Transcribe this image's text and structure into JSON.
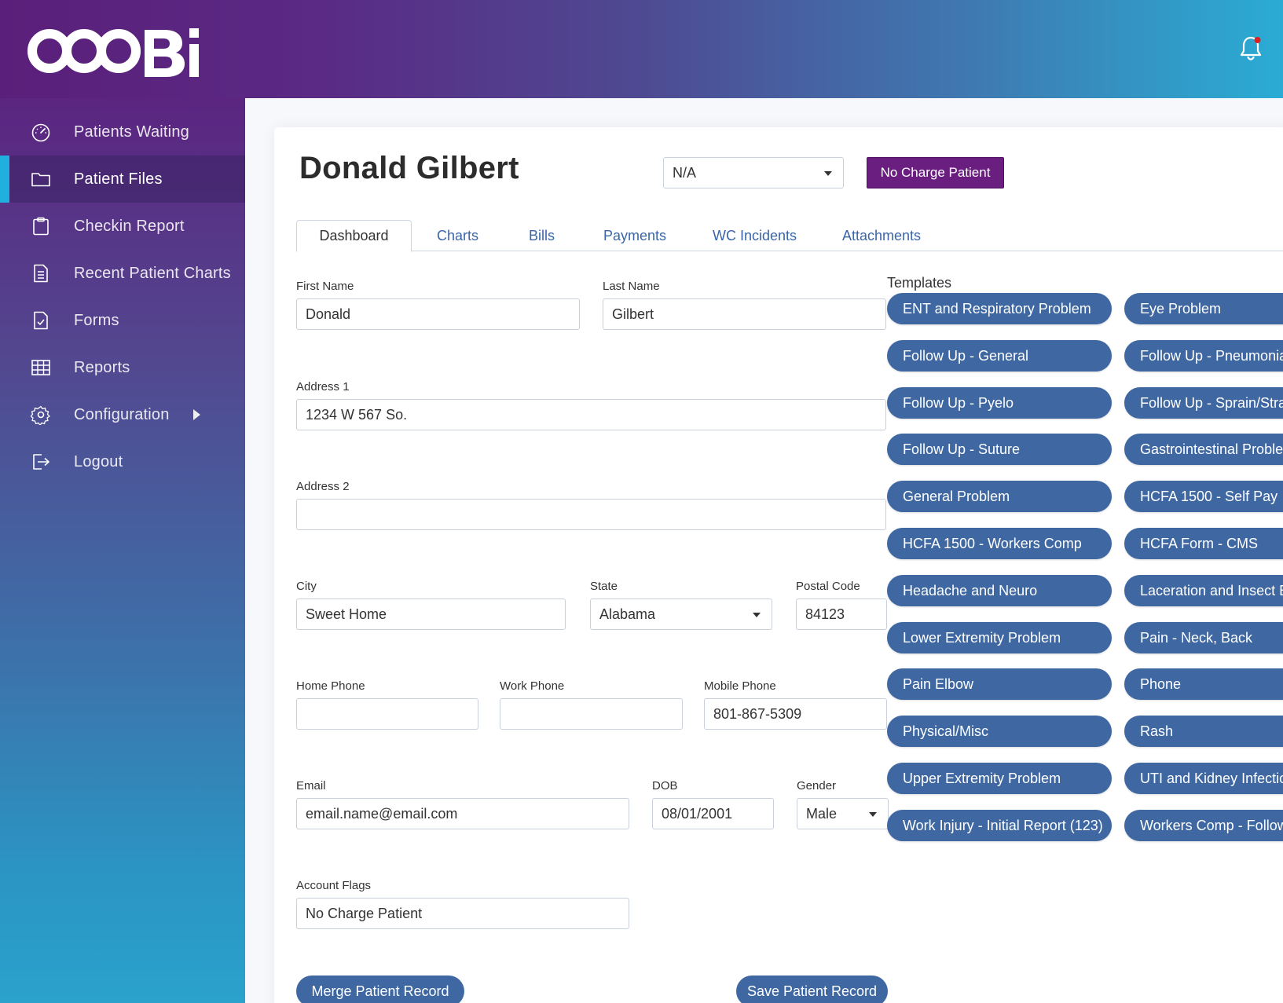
{
  "brand": {
    "logo_text": "OOOBi"
  },
  "sidebar": {
    "items": [
      {
        "label": "Patients Waiting",
        "icon": "dashboard-gauge-icon"
      },
      {
        "label": "Patient Files",
        "icon": "folder-icon",
        "active": true
      },
      {
        "label": "Checkin Report",
        "icon": "clipboard-icon"
      },
      {
        "label": "Recent Patient Charts",
        "icon": "document-icon"
      },
      {
        "label": "Forms",
        "icon": "form-check-icon"
      },
      {
        "label": "Reports",
        "icon": "table-grid-icon"
      },
      {
        "label": "Configuration",
        "icon": "gear-icon",
        "has_submenu": true
      },
      {
        "label": "Logout",
        "icon": "logout-icon"
      }
    ]
  },
  "header": {
    "notification_icon": "bell-icon",
    "has_unread": true
  },
  "patient": {
    "name": "Donald Gilbert",
    "status_select": "N/A",
    "no_charge_button": "No Charge Patient"
  },
  "tabs": [
    {
      "label": "Dashboard",
      "active": true
    },
    {
      "label": "Charts"
    },
    {
      "label": "Bills"
    },
    {
      "label": "Payments"
    },
    {
      "label": "WC Incidents"
    },
    {
      "label": "Attachments"
    }
  ],
  "form": {
    "first_name": {
      "label": "First Name",
      "value": "Donald"
    },
    "last_name": {
      "label": "Last Name",
      "value": "Gilbert"
    },
    "address1": {
      "label": "Address 1",
      "value": "1234 W 567 So."
    },
    "address2": {
      "label": "Address 2",
      "value": ""
    },
    "city": {
      "label": "City",
      "value": "Sweet Home"
    },
    "state": {
      "label": "State",
      "value": "Alabama"
    },
    "postal_code": {
      "label": "Postal Code",
      "value": "84123"
    },
    "home_phone": {
      "label": "Home Phone",
      "value": ""
    },
    "work_phone": {
      "label": "Work Phone",
      "value": ""
    },
    "mobile_phone": {
      "label": "Mobile Phone",
      "value": "801-867-5309"
    },
    "email": {
      "label": "Email",
      "value": "email.name@email.com"
    },
    "dob": {
      "label": "DOB",
      "value": "08/01/2001"
    },
    "gender": {
      "label": "Gender",
      "value": "Male"
    },
    "account_flags": {
      "label": "Account Flags",
      "value": "No Charge Patient"
    }
  },
  "actions": {
    "merge": "Merge Patient Record",
    "save": "Save Patient Record"
  },
  "templates": {
    "label": "Templates",
    "items": [
      "ENT and Respiratory Problem",
      "Eye Problem",
      "Follow Up - General",
      "Follow Up - Pneumonia",
      "Follow Up - Pyelo",
      "Follow Up - Sprain/Strain",
      "Follow Up - Suture",
      "Gastrointestinal Problem",
      "General Problem",
      "HCFA 1500 - Self Pay",
      "HCFA 1500 - Workers Comp",
      "HCFA Form - CMS",
      "Headache and Neuro",
      "Laceration and Insect Bite",
      "Lower Extremity Problem",
      "Pain - Neck, Back",
      "Pain Elbow",
      "Phone",
      "Physical/Misc",
      "Rash",
      "Upper Extremity Problem",
      "UTI and Kidney Infection",
      "Work Injury - Initial Report (123)",
      "Workers Comp - Follow Up"
    ]
  },
  "colors": {
    "brand_purple": "#6a1f80",
    "template_blue": "#3f68a3",
    "active_indicator": "#1fb0e0",
    "notification_dot": "#e02020"
  }
}
